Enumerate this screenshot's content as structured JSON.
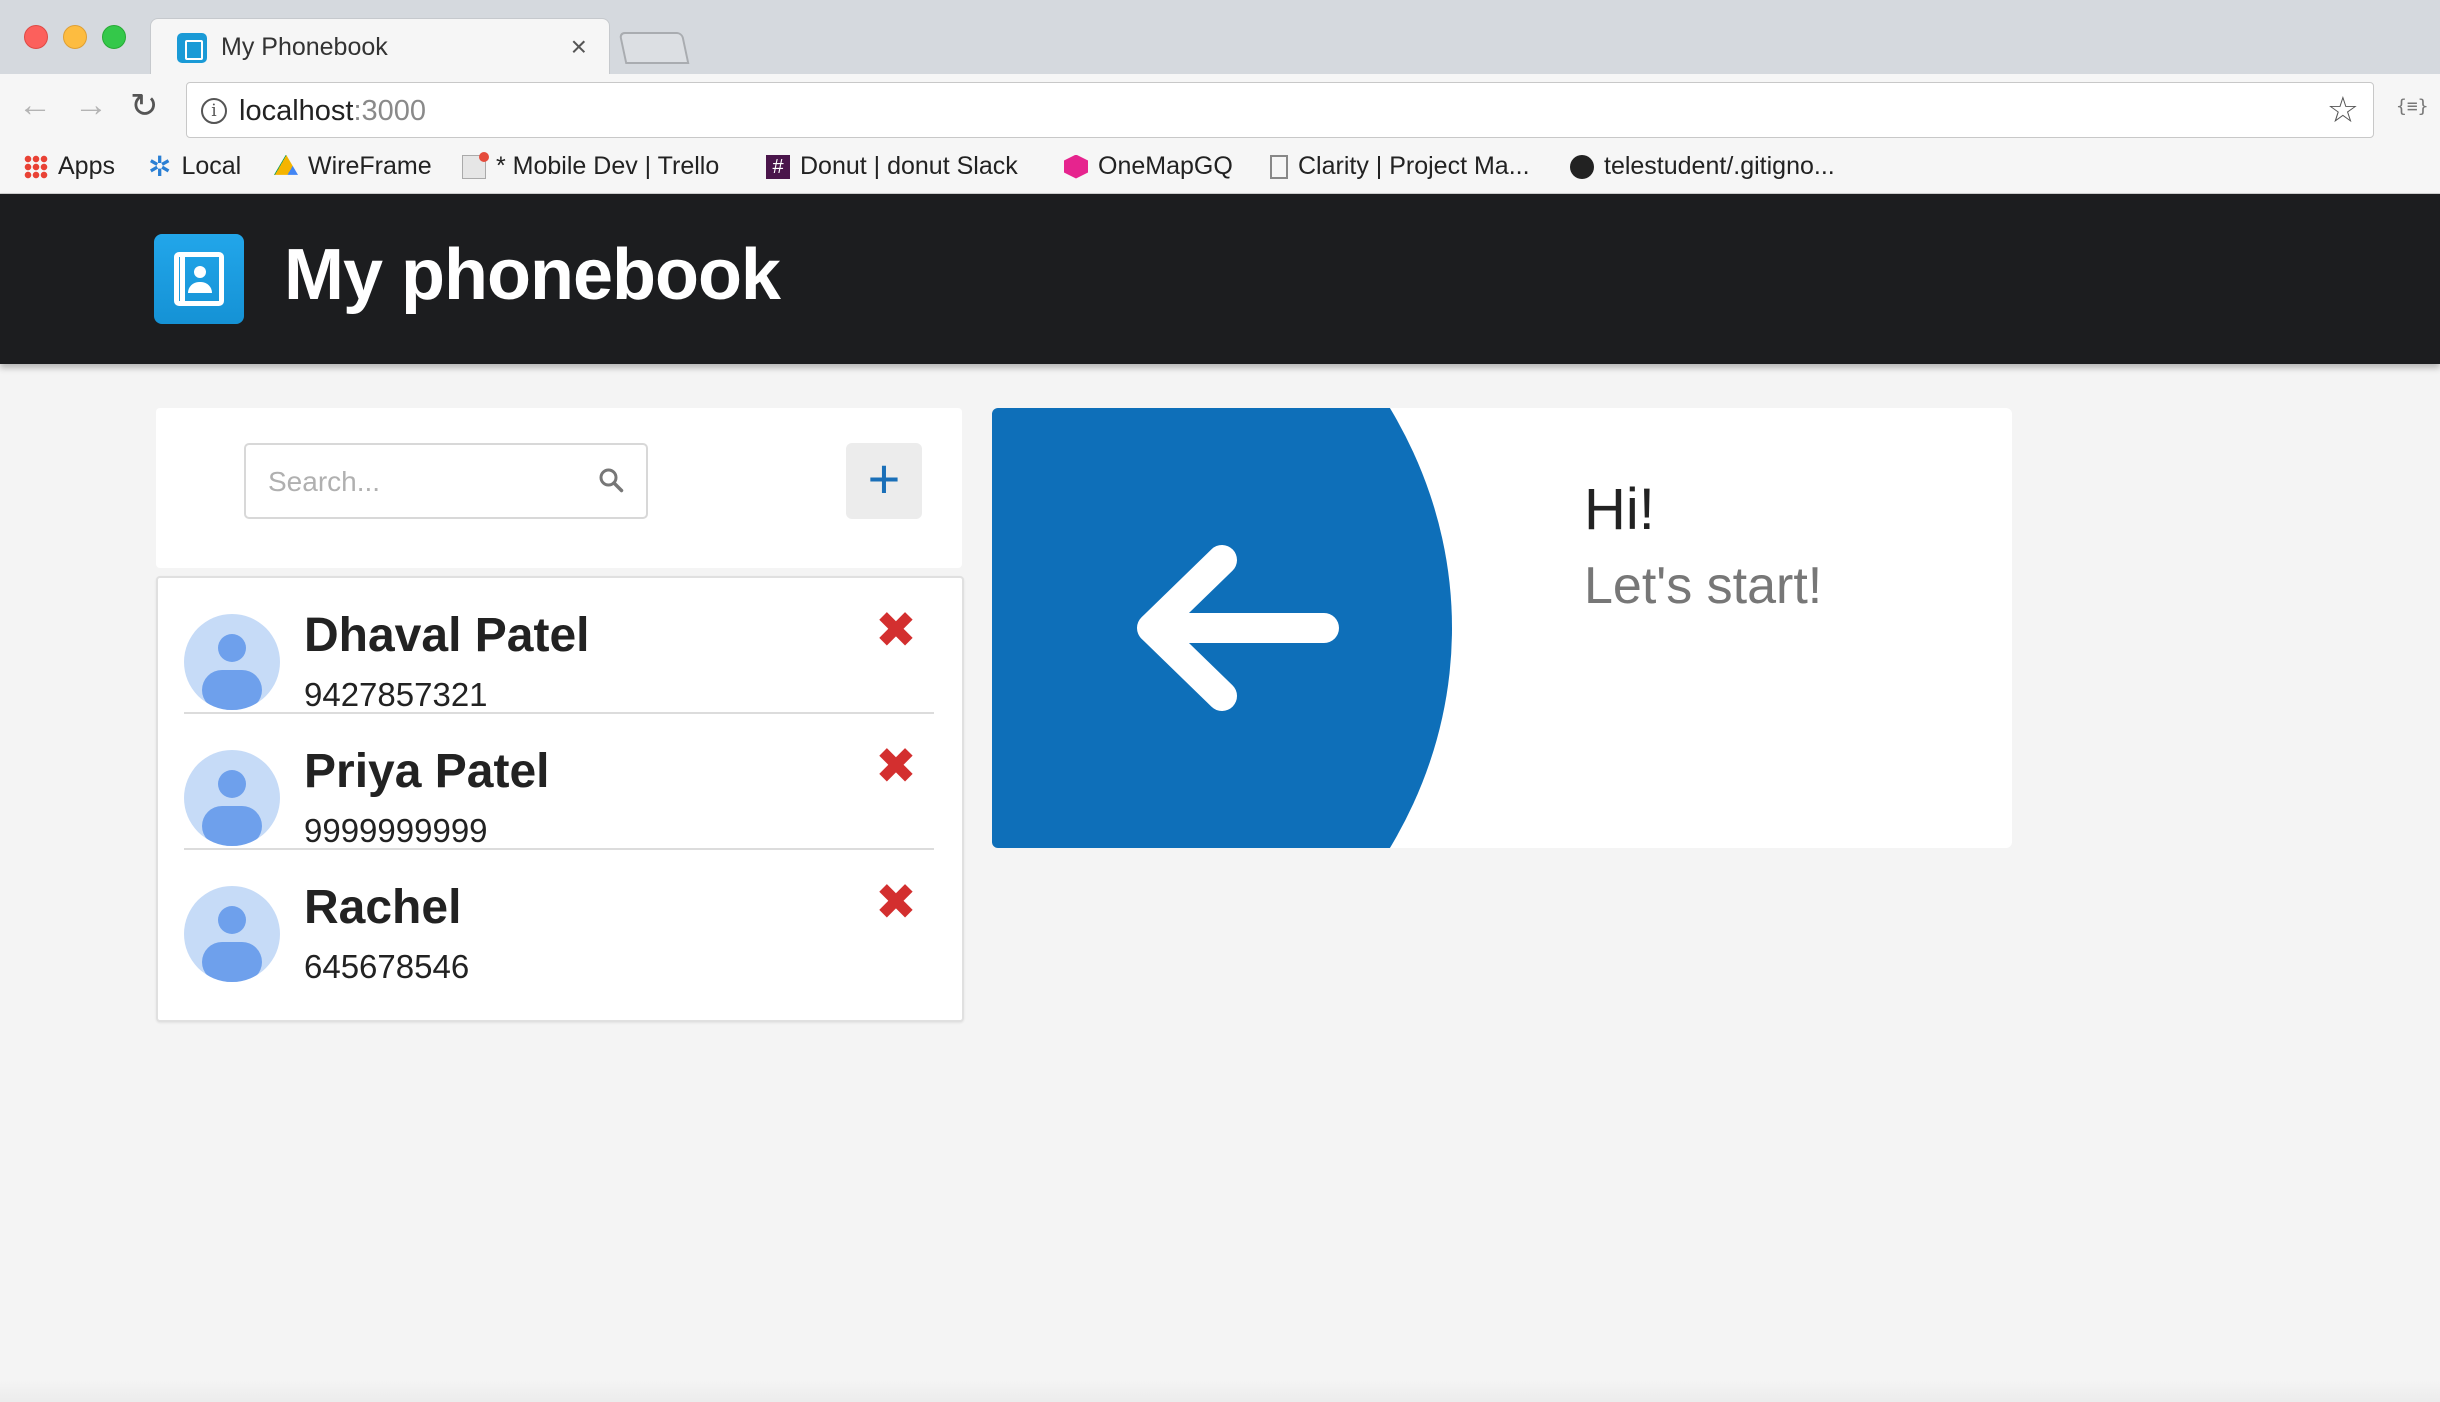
{
  "browser": {
    "tab_title": "My Phonebook",
    "tab_close": "×",
    "url_host": "localhost",
    "url_port": ":3000",
    "info_glyph": "i",
    "back_glyph": "←",
    "forward_glyph": "→",
    "reload_glyph": "↻",
    "star_glyph": "☆",
    "extension_glyph": "{≡}",
    "bookmarks": [
      {
        "label": "Apps",
        "icon": "apps-grid-icon"
      },
      {
        "label": "Local",
        "icon": "gear-icon"
      },
      {
        "label": "WireFrame",
        "icon": "google-drive-icon"
      },
      {
        "label": "* Mobile Dev | Trello",
        "icon": "trello-icon"
      },
      {
        "label": "Donut | donut Slack",
        "icon": "slack-icon"
      },
      {
        "label": "OneMapGQ",
        "icon": "graphql-icon"
      },
      {
        "label": "Clarity | Project Ma...",
        "icon": "document-icon"
      },
      {
        "label": "telestudent/.gitigno...",
        "icon": "github-icon"
      }
    ]
  },
  "header": {
    "title": "My phonebook",
    "logo_icon": "contacts-book-icon"
  },
  "search": {
    "placeholder": "Search...",
    "add_label": "+"
  },
  "contacts": [
    {
      "name": "Dhaval Patel",
      "phone": "9427857321"
    },
    {
      "name": "Priya Patel",
      "phone": "9999999999"
    },
    {
      "name": "Rachel",
      "phone": "645678546"
    }
  ],
  "delete_glyph": "✖",
  "welcome": {
    "greeting": "Hi!",
    "subtitle": "Let's start!",
    "accent_color": "#0e6fb9"
  },
  "colors": {
    "header_bg": "#1c1d1f",
    "delete": "#d32f2f",
    "avatar_bg": "#c6dbf7"
  }
}
